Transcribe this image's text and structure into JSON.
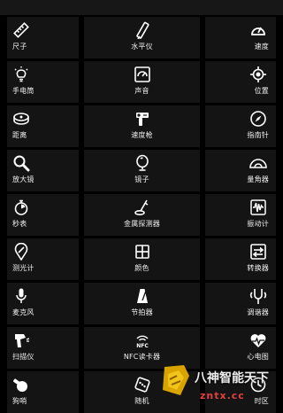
{
  "tools": [
    {
      "label": "尺子",
      "icon": "ruler-icon"
    },
    {
      "label": "水平仪",
      "icon": "level-icon"
    },
    {
      "label": "速度",
      "icon": "speedometer-icon"
    },
    {
      "label": "手电筒",
      "icon": "bulb-icon"
    },
    {
      "label": "声音",
      "icon": "sound-meter-icon"
    },
    {
      "label": "位置",
      "icon": "location-icon"
    },
    {
      "label": "距离",
      "icon": "tape-measure-icon"
    },
    {
      "label": "速度枪",
      "icon": "speed-gun-icon"
    },
    {
      "label": "指南针",
      "icon": "compass-icon"
    },
    {
      "label": "放大镜",
      "icon": "magnifier-icon"
    },
    {
      "label": "镜子",
      "icon": "mirror-icon"
    },
    {
      "label": "量角器",
      "icon": "protractor-icon"
    },
    {
      "label": "秒表",
      "icon": "stopwatch-icon"
    },
    {
      "label": "金属探测器",
      "icon": "metal-detector-icon"
    },
    {
      "label": "振动计",
      "icon": "vibration-icon"
    },
    {
      "label": "测光计",
      "icon": "light-meter-icon"
    },
    {
      "label": "颜色",
      "icon": "color-picker-icon"
    },
    {
      "label": "转换器",
      "icon": "converter-icon"
    },
    {
      "label": "麦克风",
      "icon": "microphone-icon"
    },
    {
      "label": "节拍器",
      "icon": "metronome-icon"
    },
    {
      "label": "调谐器",
      "icon": "tuner-icon"
    },
    {
      "label": "扫描仪",
      "icon": "scanner-icon"
    },
    {
      "label": "NFC读卡器",
      "icon": "nfc-icon"
    },
    {
      "label": "心电图",
      "icon": "heart-rate-icon"
    },
    {
      "label": "狗哨",
      "icon": "dog-whistle-icon"
    },
    {
      "label": "随机",
      "icon": "dice-icon"
    },
    {
      "label": "时区",
      "icon": "clock-icon"
    }
  ],
  "watermark": {
    "text": "八神智能天下",
    "url": "zntx.cc"
  },
  "colors": {
    "background": "#000000",
    "tile": "#141414",
    "text": "#f0f0f0",
    "watermark_accent": "#e04040"
  }
}
